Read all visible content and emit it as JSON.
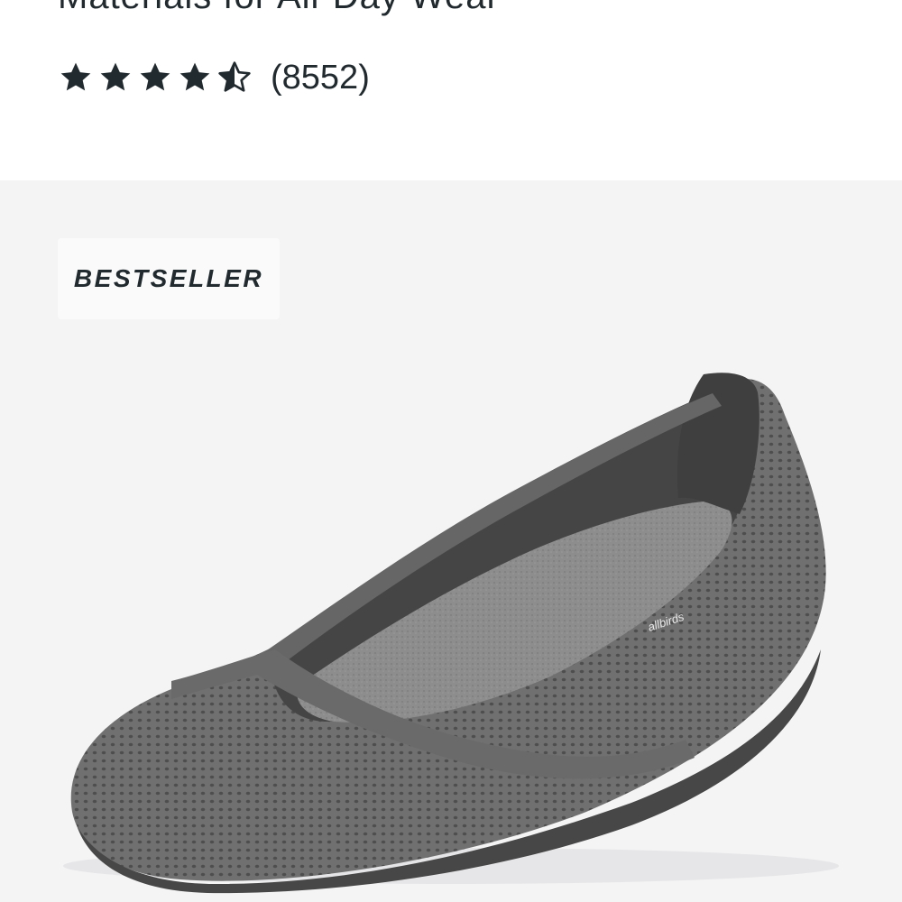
{
  "product": {
    "subtitle": "Materials for All-Day Wear",
    "rating_value": 4.5,
    "rating_max": 5,
    "review_count": "(8552)",
    "badge": "BESTSELLER",
    "image_alt": "grey knit ballet flat"
  },
  "colors": {
    "text": "#212a2f",
    "card_bg": "#f4f4f5",
    "badge_bg": "#fafafa",
    "shoe_knit": "#6c6c6c",
    "shoe_dark": "#4f4f4f",
    "insole": "#8a8a8a"
  },
  "icons": [
    "star-full-icon",
    "star-half-icon"
  ]
}
